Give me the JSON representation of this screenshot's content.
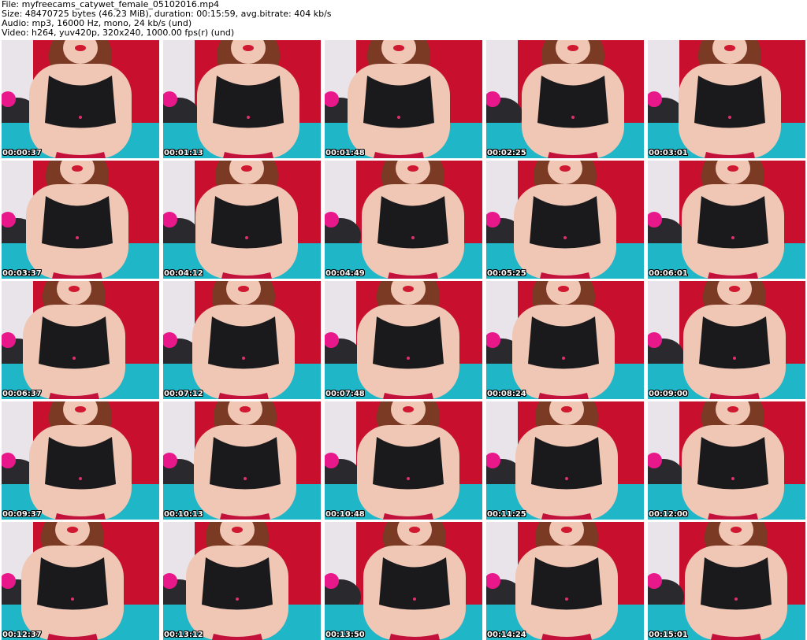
{
  "header": {
    "file": "File: myfreecams_catywet_female_05102016.mp4",
    "size": "Size: 48470725 bytes (46.23 MiB), duration: 00:15:59, avg.bitrate: 404 kb/s",
    "audio": "Audio: mp3, 16000 Hz, mono, 24 kb/s (und)",
    "video": "Video: h264, yuv420p, 320x240, 1000.00 fps(r) (und)"
  },
  "colors": {
    "curtain_red": "#c8102e",
    "bed_cyan": "#1fb6c8",
    "top_black": "#1a1a1d",
    "skin": "#f0c6b4",
    "hair": "#7a3a24",
    "pink_ball": "#e8188a",
    "timestamp_text": "#ffffff"
  },
  "frames": [
    {
      "time": "00:00:37"
    },
    {
      "time": "00:01:13"
    },
    {
      "time": "00:01:48"
    },
    {
      "time": "00:02:25"
    },
    {
      "time": "00:03:01"
    },
    {
      "time": "00:03:37"
    },
    {
      "time": "00:04:12"
    },
    {
      "time": "00:04:49"
    },
    {
      "time": "00:05:25"
    },
    {
      "time": "00:06:01"
    },
    {
      "time": "00:06:37"
    },
    {
      "time": "00:07:12"
    },
    {
      "time": "00:07:48"
    },
    {
      "time": "00:08:24"
    },
    {
      "time": "00:09:00"
    },
    {
      "time": "00:09:37"
    },
    {
      "time": "00:10:13"
    },
    {
      "time": "00:10:48"
    },
    {
      "time": "00:11:25"
    },
    {
      "time": "00:12:00"
    },
    {
      "time": "00:12:37"
    },
    {
      "time": "00:13:12"
    },
    {
      "time": "00:13:50"
    },
    {
      "time": "00:14:24"
    },
    {
      "time": "00:15:01"
    }
  ]
}
